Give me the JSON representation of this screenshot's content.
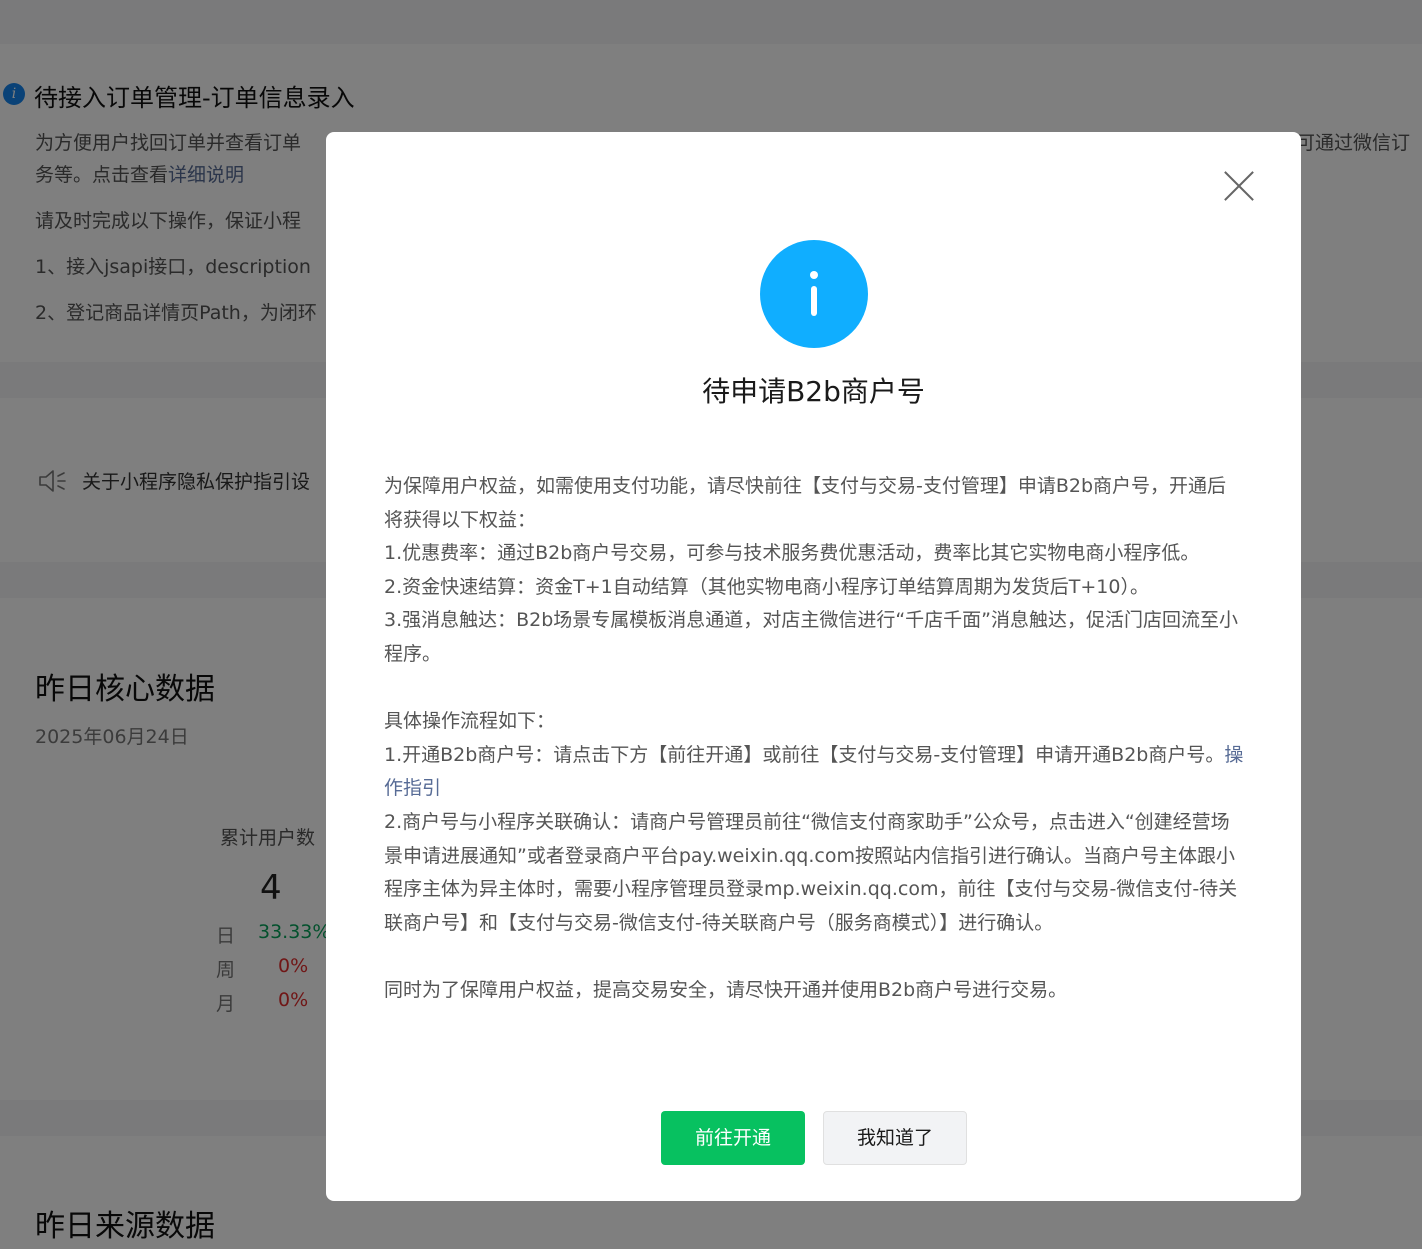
{
  "notice": {
    "title": "待接入订单管理-订单信息录入",
    "line1": "为方便用户找回订单并查看订单",
    "line1_right": "可通过微信订",
    "line1b_prefix": "务等。点击查看",
    "line1b_link": "详细说明",
    "line2": "请及时完成以下操作，保证小程",
    "line3": "1、接入jsapi接口，description",
    "line4": "2、登记商品详情页Path，为闭环"
  },
  "privacy": {
    "text": "关于小程序隐私保护指引设"
  },
  "core_data": {
    "title": "昨日核心数据",
    "date": "2025年06月24日",
    "metric_label": "累计用户数",
    "metric_value": "4",
    "trends": [
      {
        "label": "日",
        "value": "33.33%"
      },
      {
        "label": "周",
        "value": "0%"
      },
      {
        "label": "月",
        "value": "0%"
      }
    ]
  },
  "source_data": {
    "title": "昨日来源数据"
  },
  "modal": {
    "title": "待申请B2b商户号",
    "p1": "为保障用户权益，如需使用支付功能，请尽快前往【支付与交易-支付管理】申请B2b商户号，开通后将获得以下权益：",
    "p2": "1.优惠费率：通过B2b商户号交易，可参与技术服务费优惠活动，费率比其它实物电商小程序低。",
    "p3": "2.资金快速结算：资金T+1自动结算（其他实物电商小程序订单结算周期为发货后T+10）。",
    "p4": "3.强消息触达：B2b场景专属模板消息通道，对店主微信进行“千店千面”消息触达，促活门店回流至小程序。",
    "p5": "具体操作流程如下：",
    "p6_text": "1.开通B2b商户号：请点击下方【前往开通】或前往【支付与交易-支付管理】申请开通B2b商户号。",
    "p6_link": "操作指引",
    "p7": "2.商户号与小程序关联确认：请商户号管理员前往“微信支付商家助手”公众号，点击进入“创建经营场景申请进展通知”或者登录商户平台pay.weixin.qq.com按照站内信指引进行确认。当商户号主体跟小程序主体为异主体时，需要小程序管理员登录mp.weixin.qq.com，前往【支付与交易-微信支付-待关联商户号】和【支付与交易-微信支付-待关联商户号（服务商模式）】进行确认。",
    "p8": "同时为了保障用户权益，提高交易安全，请尽快开通并使用B2b商户号进行交易。",
    "primary_button": "前往开通",
    "secondary_button": "我知道了",
    "icon": "info-icon",
    "close_icon": "close-icon"
  },
  "colors": {
    "primary": "#07c160",
    "info": "#10aeff",
    "link": "#576b95",
    "up": "#07a25a",
    "down": "#e02d2d"
  }
}
